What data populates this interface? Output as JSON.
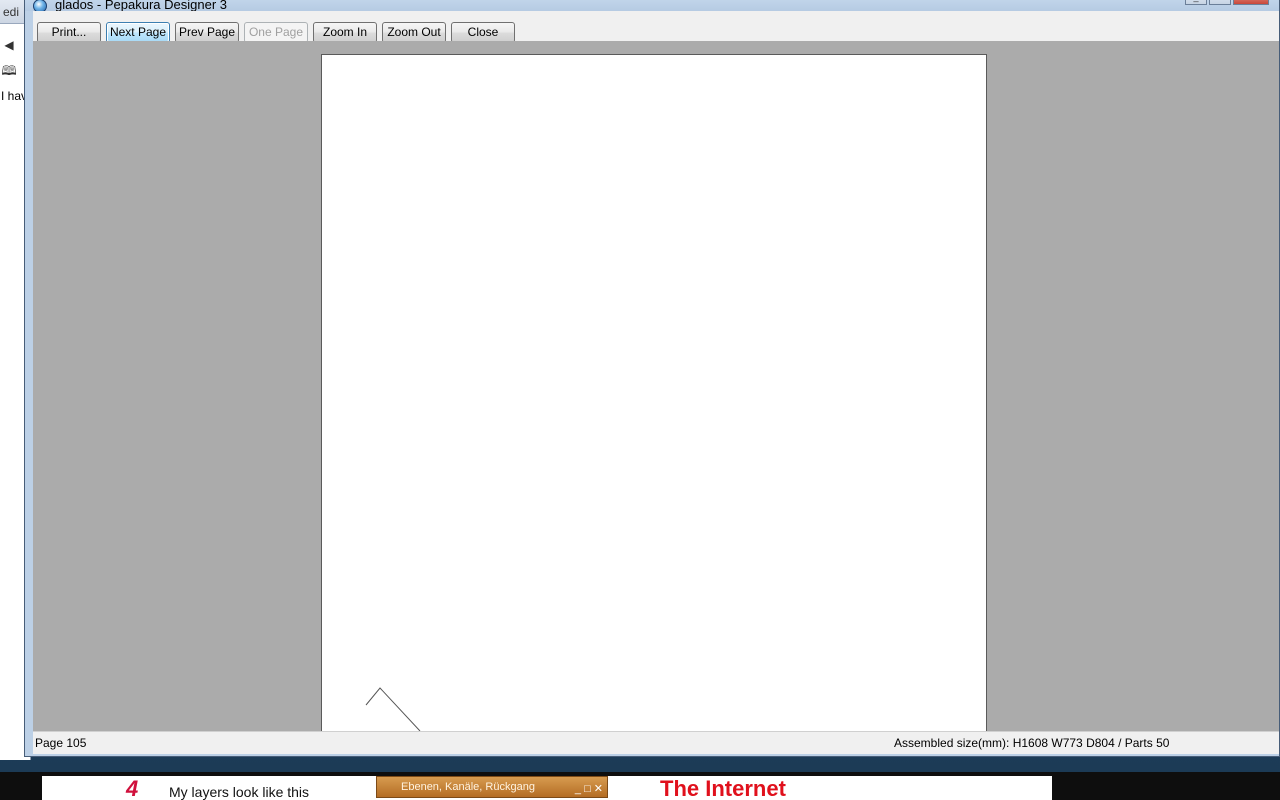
{
  "background": {
    "browser": {
      "address_fragment": "edi",
      "back_glyph": "◀",
      "bookmark_glyph": "🕮",
      "text_fragment": "I hav"
    },
    "bottom_page": {
      "red_glyph": "4",
      "layers_text": "My layers look like this",
      "mini_window_title": "Ebenen, Kanäle, Rückgang",
      "mini_window_controls": "_ □ ✕",
      "internet_text": "The Internet"
    }
  },
  "window": {
    "title": "glados - Pepakura Designer 3",
    "app_icon": "pepakura-globe-icon",
    "controls": {
      "minimize": "_",
      "maximize": "□",
      "close": "✕"
    }
  },
  "toolbar": {
    "print_label": "Print...",
    "next_page_label": "Next Page",
    "prev_page_label": "Prev Page",
    "one_page_label": "One Page",
    "zoom_in_label": "Zoom In",
    "zoom_out_label": "Zoom Out",
    "close_label": "Close"
  },
  "status": {
    "page": "Page 105",
    "assembled_size": "Assembled size(mm): H1608 W773 D804 / Parts 50"
  },
  "colors": {
    "preview_background": "#ababab",
    "paper": "#ffffff",
    "focused_button_border": "#3c7fb1",
    "disabled_text": "#a0a0a0"
  }
}
